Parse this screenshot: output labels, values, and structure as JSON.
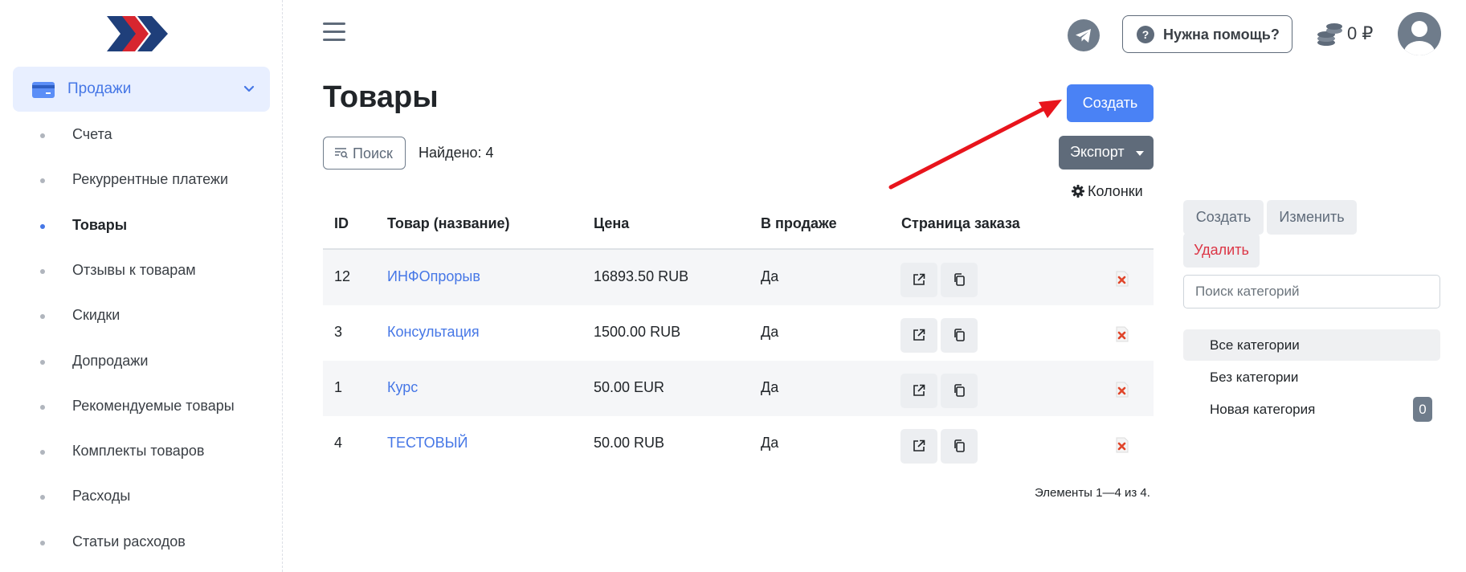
{
  "sidebar": {
    "parent": {
      "label": "Продажи"
    },
    "items": [
      {
        "label": "Счета"
      },
      {
        "label": "Рекуррентные платежи"
      },
      {
        "label": "Товары",
        "active": true
      },
      {
        "label": "Отзывы к товарам"
      },
      {
        "label": "Скидки"
      },
      {
        "label": "Допродажи"
      },
      {
        "label": "Рекомендуемые товары"
      },
      {
        "label": "Комплекты товаров"
      },
      {
        "label": "Расходы"
      },
      {
        "label": "Статьи расходов"
      }
    ]
  },
  "header": {
    "help_label": "Нужна помощь?",
    "help_icon": "?",
    "balance": "0 ₽"
  },
  "main": {
    "title": "Товары",
    "create_label": "Создать",
    "search_label": "Поиск",
    "found_label": "Найдено: 4",
    "export_label": "Экспорт",
    "columns_label": "Колонки",
    "table": {
      "headers": [
        "ID",
        "Товар (название)",
        "Цена",
        "В продаже",
        "Страница заказа"
      ],
      "rows": [
        {
          "id": "12",
          "name": "ИНФОпрорыв",
          "price": "16893.50 RUB",
          "on_sale": "Да"
        },
        {
          "id": "3",
          "name": "Консультация",
          "price": "1500.00 RUB",
          "on_sale": "Да"
        },
        {
          "id": "1",
          "name": "Курс",
          "price": "50.00 EUR",
          "on_sale": "Да"
        },
        {
          "id": "4",
          "name": "ТЕСТОВЫЙ",
          "price": "50.00 RUB",
          "on_sale": "Да"
        }
      ]
    },
    "pager": "Элементы 1—4 из 4."
  },
  "categories": {
    "create_label": "Создать",
    "edit_label": "Изменить",
    "delete_label": "Удалить",
    "search_placeholder": "Поиск категорий",
    "items": [
      {
        "label": "Все категории",
        "active": true
      },
      {
        "label": "Без категории"
      },
      {
        "label": "Новая категория",
        "count": "0"
      }
    ]
  },
  "colors": {
    "accent": "#4a82f5",
    "secondary": "#5f6b7a",
    "link": "#4677e6",
    "danger": "#dc3545",
    "annotation_arrow": "#e8141c"
  }
}
